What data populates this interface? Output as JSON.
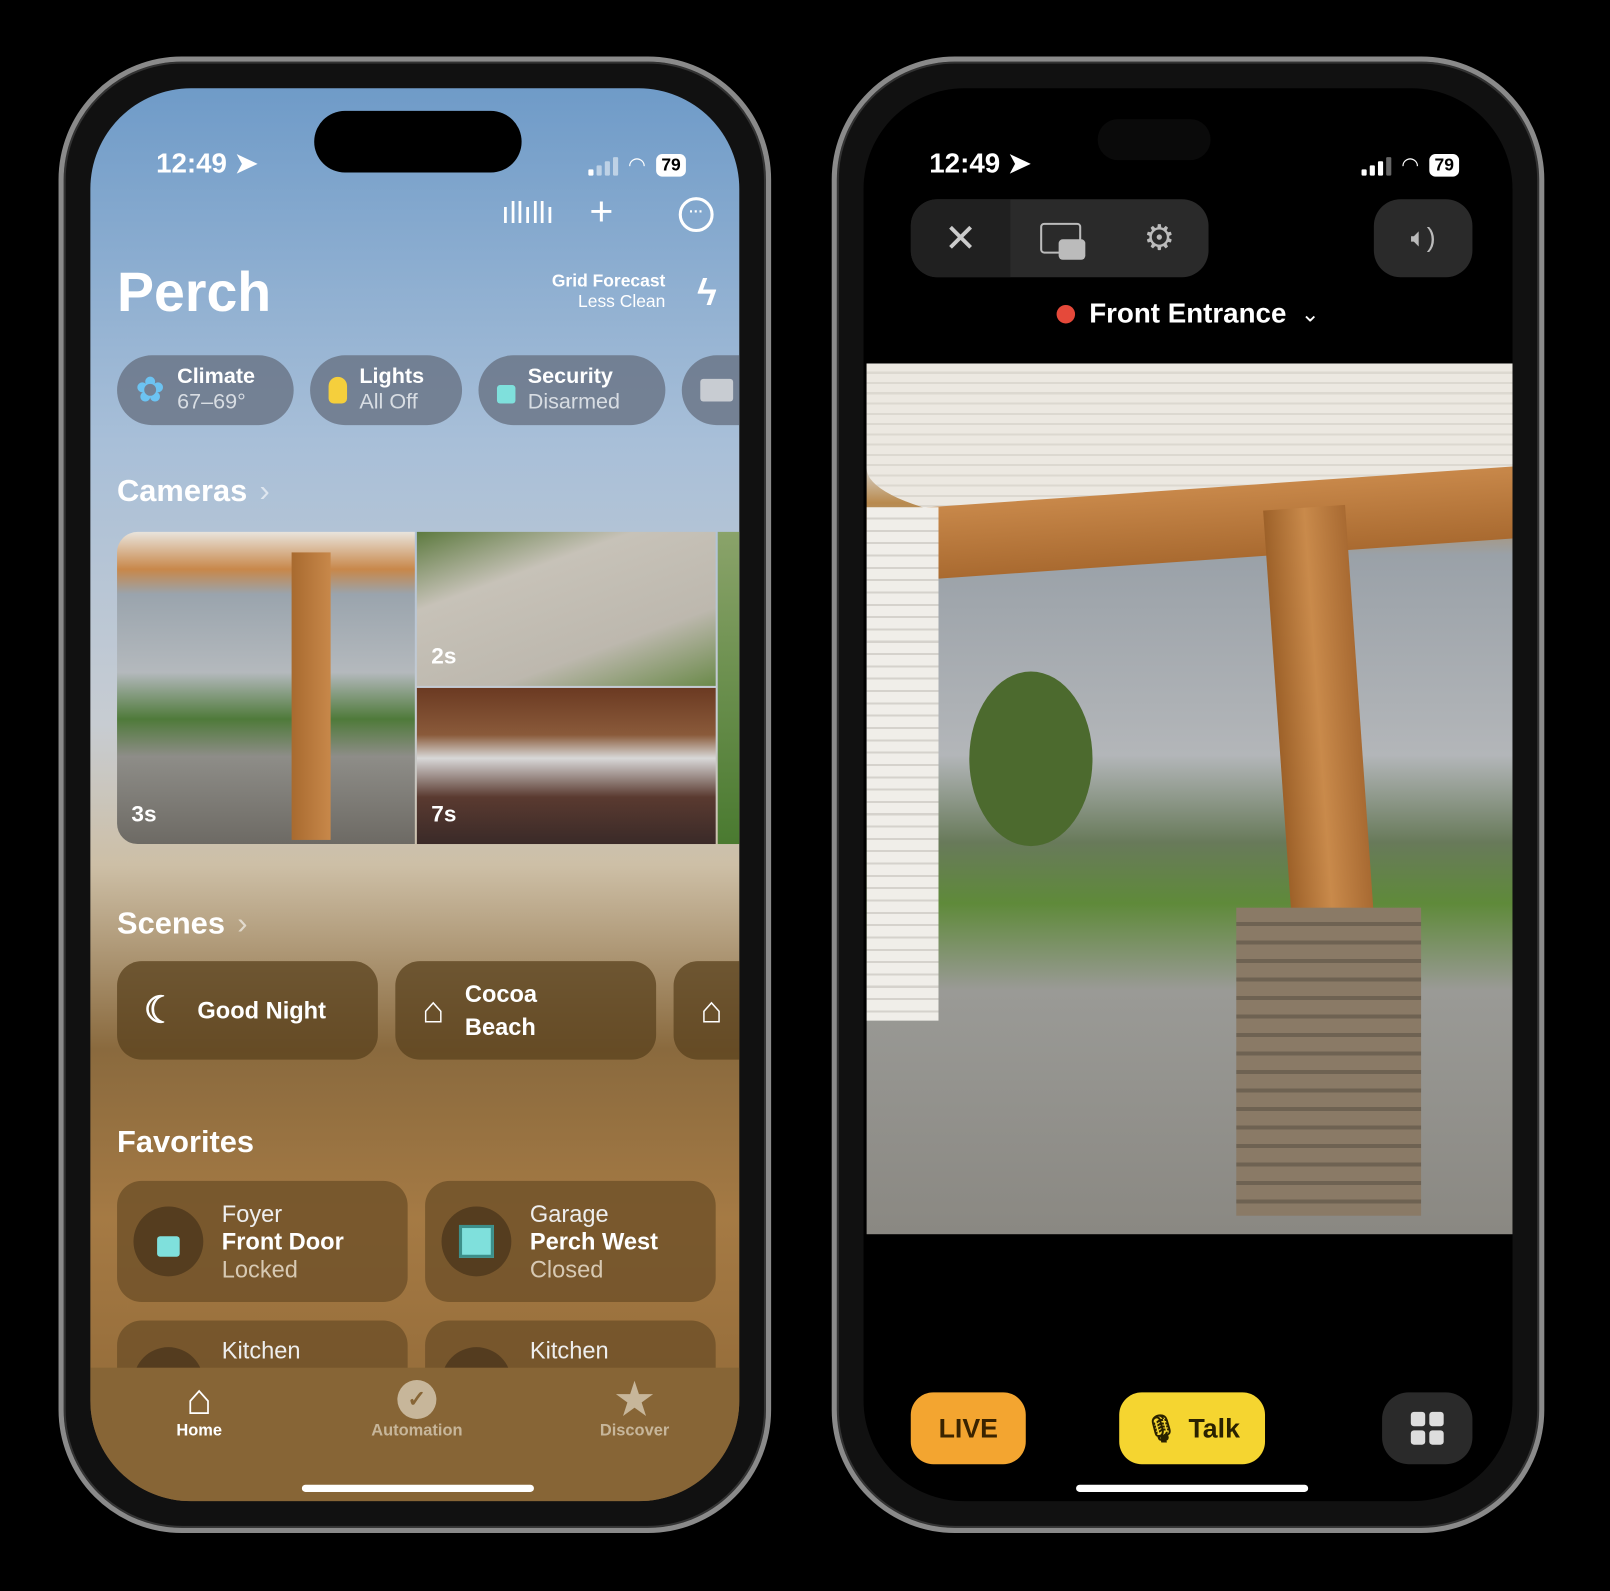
{
  "left_phone": {
    "status": {
      "time": "12:49",
      "battery": "79"
    },
    "toolbar_icons": [
      "intercom-icon",
      "plus-icon",
      "more-icon"
    ],
    "home_name": "Perch",
    "grid_forecast": {
      "title": "Grid Forecast",
      "value": "Less Clean"
    },
    "category_pills": [
      {
        "title": "Climate",
        "subtitle": "67–69°",
        "icon": "fan-icon",
        "color": "#6cc3f2"
      },
      {
        "title": "Lights",
        "subtitle": "All Off",
        "icon": "lightbulb-icon",
        "color": "#f5cf3c"
      },
      {
        "title": "Security",
        "subtitle": "Disarmed",
        "icon": "lock-icon",
        "color": "#7fe0dc"
      }
    ],
    "cameras": {
      "title": "Cameras",
      "tiles": [
        {
          "label": "3s"
        },
        {
          "label": "2s"
        },
        {
          "label": "7s"
        }
      ]
    },
    "scenes": {
      "title": "Scenes",
      "items": [
        {
          "label": "Good Night",
          "icon": "moon-icon"
        },
        {
          "label": "Cocoa Beach",
          "icon": "house-icon"
        }
      ]
    },
    "favorites": {
      "title": "Favorites",
      "items": [
        {
          "room": "Foyer",
          "name": "Front Door",
          "state": "Locked",
          "icon": "lock-icon"
        },
        {
          "room": "Garage",
          "name": "Perch West",
          "state": "Closed",
          "icon": "garage-door-icon"
        },
        {
          "room": "Kitchen",
          "name": "",
          "state": "",
          "icon": ""
        },
        {
          "room": "Kitchen",
          "name": "",
          "state": "",
          "icon": "outlet-icon"
        }
      ]
    },
    "tabs": [
      {
        "label": "Home",
        "active": true
      },
      {
        "label": "Automation",
        "active": false
      },
      {
        "label": "Discover",
        "active": false
      }
    ]
  },
  "right_phone": {
    "status": {
      "time": "12:49",
      "battery": "79"
    },
    "camera_name": "Front Entrance",
    "recording_color": "#e5493a",
    "live_label": "LIVE",
    "talk_label": "Talk",
    "live_color": "#f3a530",
    "talk_color": "#f5d530"
  }
}
